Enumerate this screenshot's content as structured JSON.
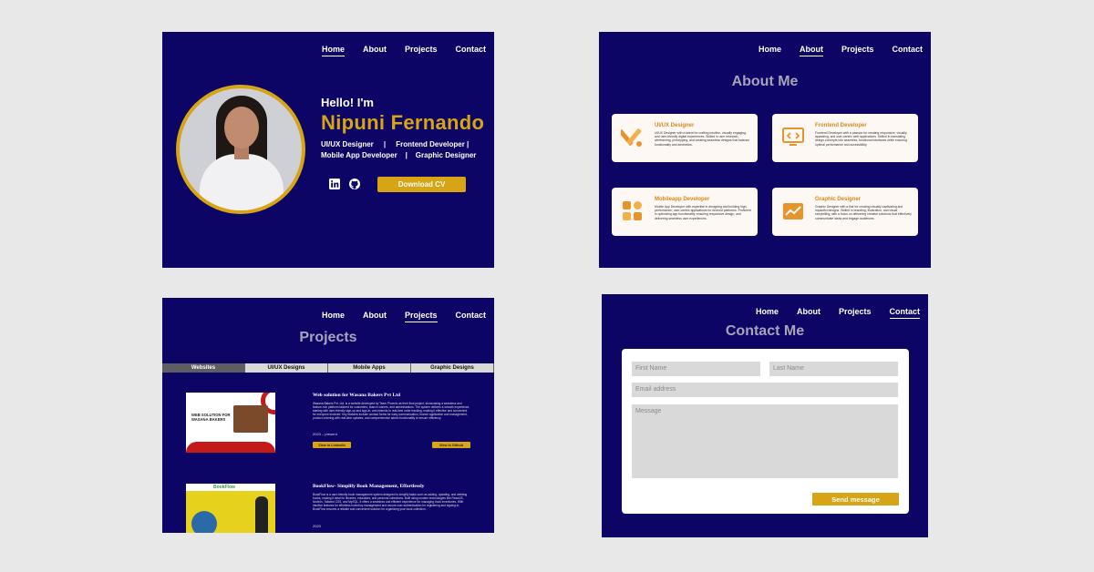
{
  "colors": {
    "panel_bg": "#0d0566",
    "accent": "#d6a414",
    "page_bg": "#e8e8e9"
  },
  "hero": {
    "nav": [
      "Home",
      "About",
      "Projects",
      "Contact"
    ],
    "active_nav": "Home",
    "greeting": "Hello! I'm",
    "name": "Nipuni Fernando",
    "roles_line1": "UI/UX Designer     |     Frontend Developer |",
    "roles_line2": "Mobile App Developer    |    Graphic Designer",
    "social_icons": [
      "linkedin-icon",
      "github-icon"
    ],
    "cv_button": "Download CV"
  },
  "about": {
    "nav": [
      "Home",
      "About",
      "Projects",
      "Contact"
    ],
    "active_nav": "About",
    "title": "About Me",
    "cards": [
      {
        "title": "UI/UX Designer",
        "icon": "design-tools-icon",
        "desc": "UI/UX Designer with a talent for crafting intuitive, visually engaging, and user-friendly digital experiences. Skilled in user research, wireframing, prototyping, and creating seamless designs that balance functionality and aesthetics."
      },
      {
        "title": "Frontend Developer",
        "icon": "code-monitor-icon",
        "desc": "Frontend Developer with a passion for creating responsive, visually appealing, and user-centric web applications. Skilled in translating design concepts into seamless, functional interfaces while ensuring optimal performance and accessibility."
      },
      {
        "title": "Mobileapp Developer",
        "icon": "apps-grid-icon",
        "desc": "Mobile App Developer with expertise in designing and building high-performance, user-centric applications for Android platforms. Proficient in optimizing app functionality, ensuring responsive design, and delivering seamless user experiences."
      },
      {
        "title": "Graphic Designer",
        "icon": "graphic-chart-icon",
        "desc": "Graphic Designer with a flair for creating visually captivating and impactful designs. Skilled in branding, illustration, and visual storytelling, with a focus on delivering creative solutions that effectively communicate ideas and engage audiences."
      }
    ]
  },
  "projects": {
    "nav": [
      "Home",
      "About",
      "Projects",
      "Contact"
    ],
    "active_nav": "Projects",
    "title": "Projects",
    "tabs": [
      "Websites",
      "UI/UX Designs",
      "Mobile Apps",
      "Graphic Designs"
    ],
    "active_tab": "Websites",
    "items": [
      {
        "title": "Web solution for Wasana Bakers Pvt Ltd",
        "desc": "Wasana Bakers Pvt. Ltd. is a website developed by Team Phoenix as their final project, showcasing a seamless and feature-rich platform tailored for customers, branch owners, and administrators. The system delivers a smooth experience, starting with user-friendly sign-up and sign-in, and extends to real-time order tracking, making it effective and convenient for everyone involved. Key features include contact forms for easy communication, branch application and management, product ordering with real-time updates, and comprehensive admin functionality to ensure efficiency.",
        "year": "2023 – present",
        "thumb_text": "WEB SOLUTION FOR WASANA BAKERS",
        "btn1": "View in LinkedIn",
        "btn2": "View in Github"
      },
      {
        "title": "BookFlow- Simplify Book Management, Effortlessly",
        "desc": "BookFlow is a user-friendly book management system designed to simplify tasks such as adding, updating, and deleting books, making it ideal for libraries, educators, and personal collections. Built using modern technologies like ReactJS, NodeJs, Tailwind CSS, and MySQL, it offers a seamless and efficient experience for managing book inventories. With intuitive features for effortless inventory management and secure user authentication for registering and signing in, BookFlow ensures a reliable and convenient solution for organizing your book collection.",
        "year": "2023",
        "thumb_text": "BookFlow"
      }
    ]
  },
  "contact": {
    "nav": [
      "Home",
      "About",
      "Projects",
      "Contact"
    ],
    "active_nav": "Contact",
    "title": "Contact Me",
    "first_name": "First Name",
    "last_name": "Last Name",
    "email": "Email address",
    "message": "Message",
    "send": "Send message"
  }
}
